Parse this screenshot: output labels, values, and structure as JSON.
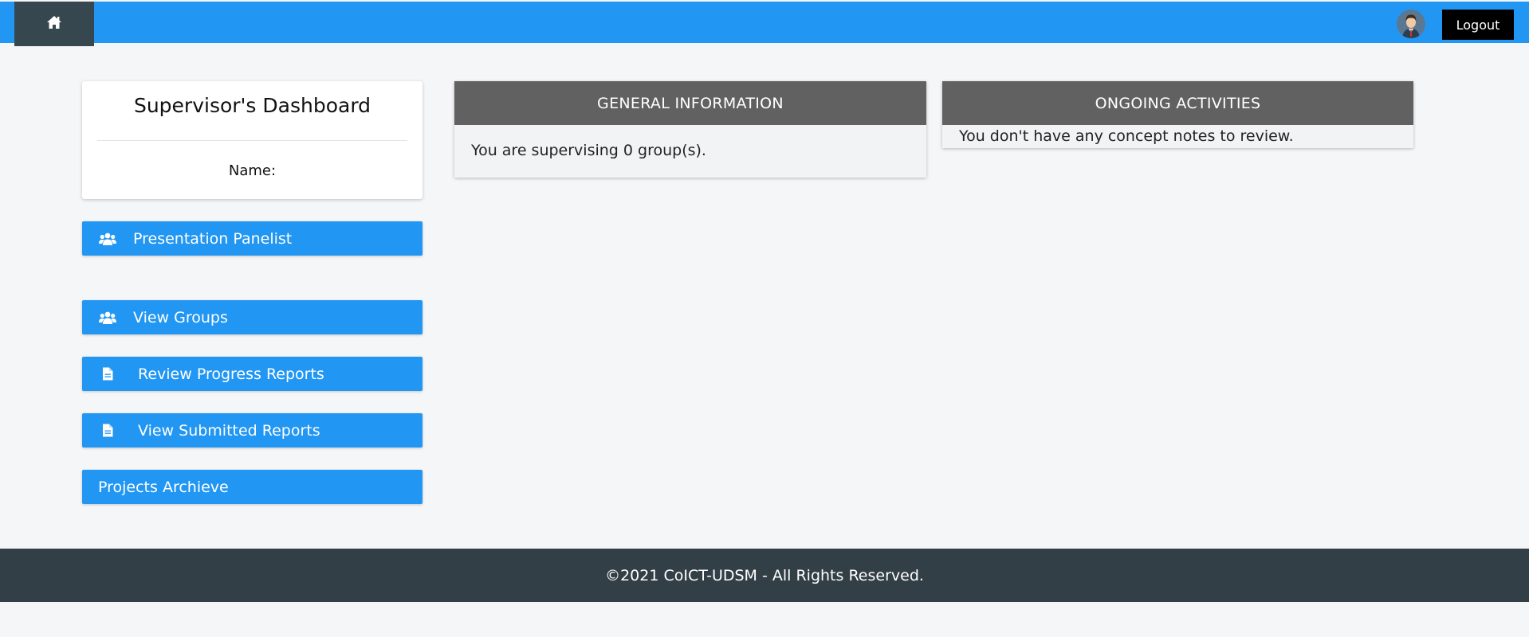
{
  "nav": {
    "home_icon": "home-icon",
    "avatar_icon": "user-avatar",
    "logout_label": "Logout"
  },
  "profile": {
    "title": "Supervisor's Dashboard",
    "name_label": "Name:"
  },
  "sidebar": {
    "items": [
      {
        "label": "Presentation Panelist",
        "icon": "users-icon"
      },
      {
        "label": "View Groups",
        "icon": "users-icon"
      },
      {
        "label": "Review Progress Reports",
        "icon": "document-icon"
      },
      {
        "label": "View Submitted Reports",
        "icon": "document-icon"
      },
      {
        "label": "Projects Archieve",
        "icon": ""
      }
    ]
  },
  "general_info": {
    "title": "GENERAL INFORMATION",
    "text": "You are supervising 0 group(s)."
  },
  "ongoing": {
    "title": "ONGOING ACTIVITIES",
    "text": "You don't have any concept notes to review."
  },
  "footer": {
    "text": "©2021 CoICT-UDSM - All Rights Reserved."
  },
  "colors": {
    "primary": "#2196f3",
    "home_button": "#37474f",
    "panel_header": "#616161",
    "footer": "#333f47",
    "page_background": "#f5f6f8"
  }
}
